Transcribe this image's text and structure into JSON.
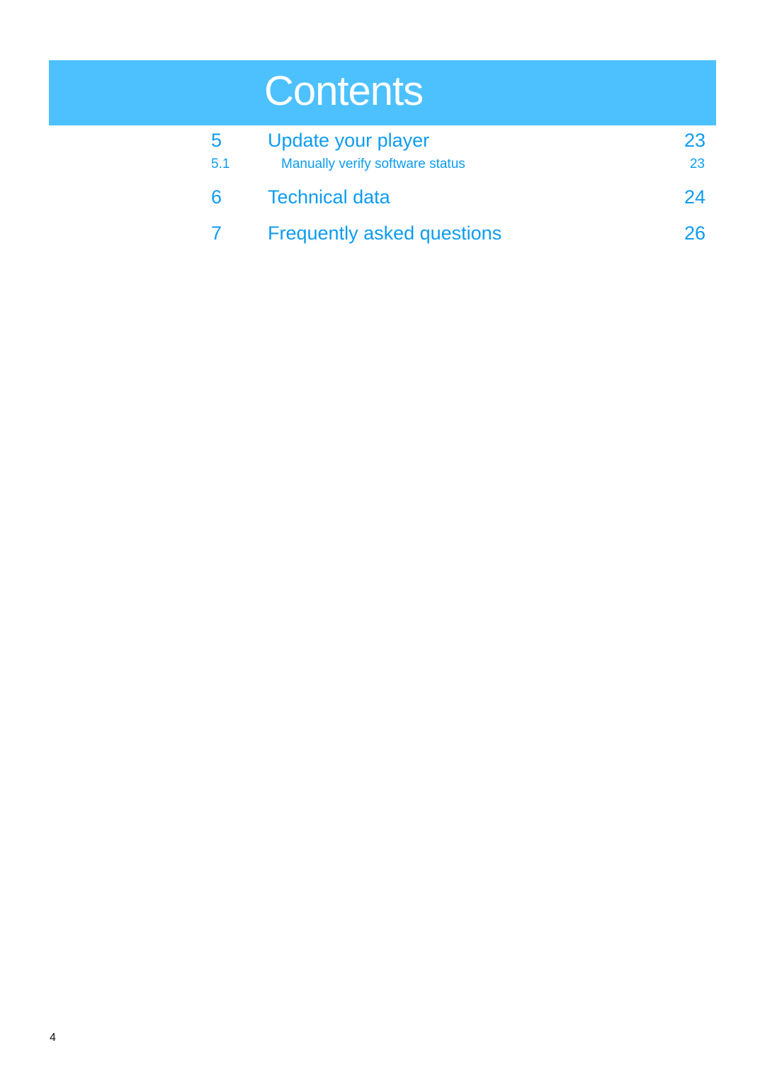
{
  "header": {
    "title": "Contents",
    "color": "#4dc1fd"
  },
  "toc": [
    {
      "number": "5",
      "label": "Update your player",
      "page": "23",
      "level": 1
    },
    {
      "number": "5.1",
      "label": "Manually verify software status",
      "page": "23",
      "level": 2
    },
    {
      "number": "6",
      "label": "Technical data",
      "page": "24",
      "level": 1
    },
    {
      "number": "7",
      "label": "Frequently asked questions",
      "page": "26",
      "level": 1
    }
  ],
  "footer": {
    "page_number": "4"
  },
  "colors": {
    "toc_text": "#0d9cf0"
  }
}
